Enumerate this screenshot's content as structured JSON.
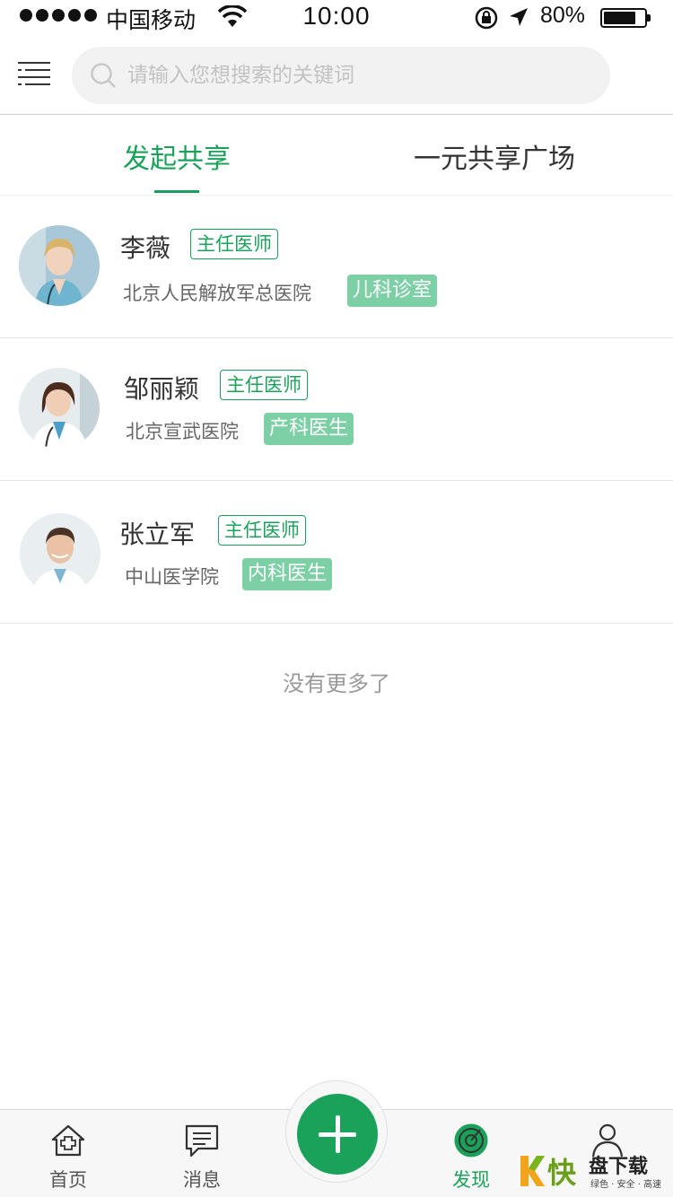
{
  "status_bar": {
    "carrier": "中国移动",
    "time": "10:00",
    "battery": "80%",
    "battery_level": 0.8
  },
  "search": {
    "placeholder": "请输入您想搜索的关键词"
  },
  "tabs": [
    {
      "label": "发起共享",
      "active": true
    },
    {
      "label": "一元共享广场",
      "active": false
    }
  ],
  "doctors": [
    {
      "name": "李薇",
      "title": "主任医师",
      "hospital": "北京人民解放军总医院",
      "department": "儿科诊室"
    },
    {
      "name": "邹丽颖",
      "title": "主任医师",
      "hospital": "北京宣武医院",
      "department": "产科医生"
    },
    {
      "name": "张立军",
      "title": "主任医师",
      "hospital": "中山医学院",
      "department": "内科医生"
    }
  ],
  "list_footer": "没有更多了",
  "bottom_nav": {
    "items": [
      {
        "label": "首页",
        "icon": "home-icon"
      },
      {
        "label": "消息",
        "icon": "message-icon"
      },
      {
        "label": "发现",
        "icon": "discover-icon",
        "active": true
      },
      {
        "label": "",
        "icon": "profile-icon"
      }
    ],
    "fab_icon": "plus-icon"
  },
  "watermark": {
    "big": "快",
    "title": "盘下载",
    "sub": "绿色 · 安全 · 高速"
  },
  "colors": {
    "accent": "#1aa25a",
    "tag_fill": "#7dd0a6",
    "search_bg": "#f2f2f2"
  }
}
